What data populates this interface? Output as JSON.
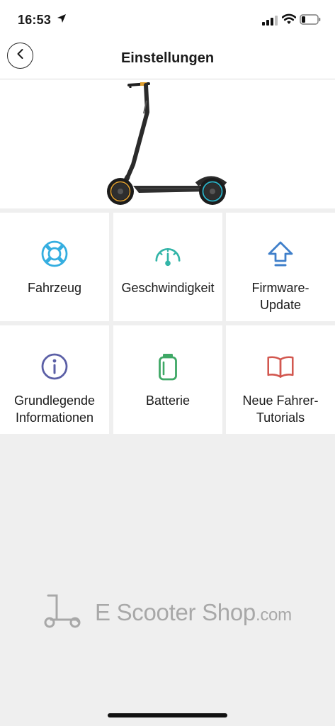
{
  "status_bar": {
    "time": "16:53",
    "icons": [
      "location-arrow-icon",
      "signal-bars-icon",
      "wifi-icon",
      "battery-low-icon"
    ]
  },
  "nav": {
    "back_icon": "chevron-left-icon",
    "title": "Einstellungen"
  },
  "hero": {
    "image": "electric-scooter"
  },
  "tiles": [
    {
      "label": "Fahrzeug",
      "icon": "lifebuoy-icon",
      "color": "#35aee0"
    },
    {
      "label": "Geschwindigkeit",
      "icon": "speedometer-icon",
      "color": "#33b5a8"
    },
    {
      "label": "Firmware-\nUpdate",
      "icon": "arrow-up-icon",
      "color": "#3f7fca"
    },
    {
      "label": "Grundlegende\nInformationen",
      "icon": "info-circle-icon",
      "color": "#5b5fa6"
    },
    {
      "label": "Batterie",
      "icon": "battery-icon",
      "color": "#3fa866"
    },
    {
      "label": "Neue Fahrer-\nTutorials",
      "icon": "open-book-icon",
      "color": "#d2574f"
    }
  ],
  "watermark": {
    "brand": "E Scooter Shop",
    "suffix": ".com",
    "logo_icon": "scooter-logo-icon"
  },
  "colors": {
    "background": "#efefef",
    "surface": "#ffffff"
  }
}
